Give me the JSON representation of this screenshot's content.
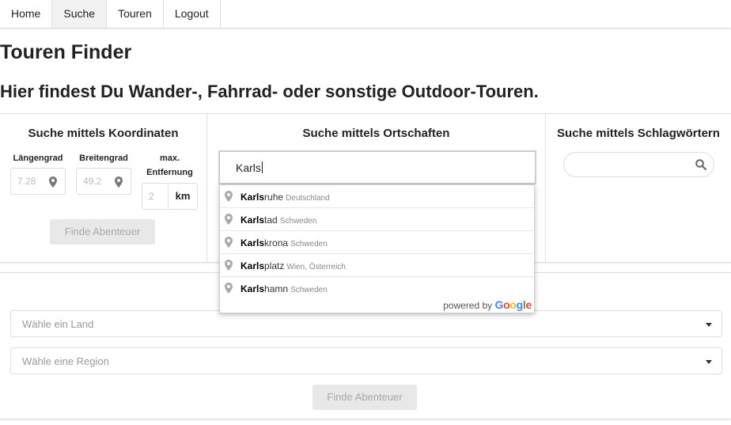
{
  "nav": {
    "items": [
      "Home",
      "Suche",
      "Touren",
      "Logout"
    ],
    "active": "Suche"
  },
  "page": {
    "title": "Touren Finder",
    "subtitle": "Hier findest Du Wander-, Fahrrad- oder sonstige Outdoor-Touren."
  },
  "coords": {
    "heading": "Suche mittels Koordinaten",
    "lon_label": "Längengrad",
    "lon_value": "7.28",
    "lat_label": "Breitengrad",
    "lat_value": "49.2",
    "dist_label_1": "max.",
    "dist_label_2": "Entfernung",
    "dist_value": "2",
    "dist_unit": "km",
    "button": "Finde Abenteuer"
  },
  "places": {
    "heading": "Suche mittels Ortschaften",
    "input_value": "Karls",
    "suggestions": [
      {
        "match": "Karls",
        "rest": "ruhe",
        "secondary": "Deutschland"
      },
      {
        "match": "Karls",
        "rest": "tad",
        "secondary": "Schweden"
      },
      {
        "match": "Karls",
        "rest": "krona",
        "secondary": "Schweden"
      },
      {
        "match": "Karls",
        "rest": "platz",
        "secondary": "Wien, Österreich"
      },
      {
        "match": "Karls",
        "rest": "hamn",
        "secondary": "Schweden"
      }
    ],
    "powered_by": "powered by",
    "google": [
      "G",
      "o",
      "o",
      "g",
      "l",
      "e"
    ]
  },
  "keywords": {
    "heading": "Suche mittels Schlagwörtern",
    "input_value": ""
  },
  "region_filter": {
    "country_placeholder": "Wähle ein Land",
    "region_placeholder": "Wähle eine Region",
    "button": "Finde Abenteuer"
  },
  "colors": {
    "google": [
      "#4285F4",
      "#EA4335",
      "#FBBC05",
      "#4285F4",
      "#34A853",
      "#EA4335"
    ]
  }
}
